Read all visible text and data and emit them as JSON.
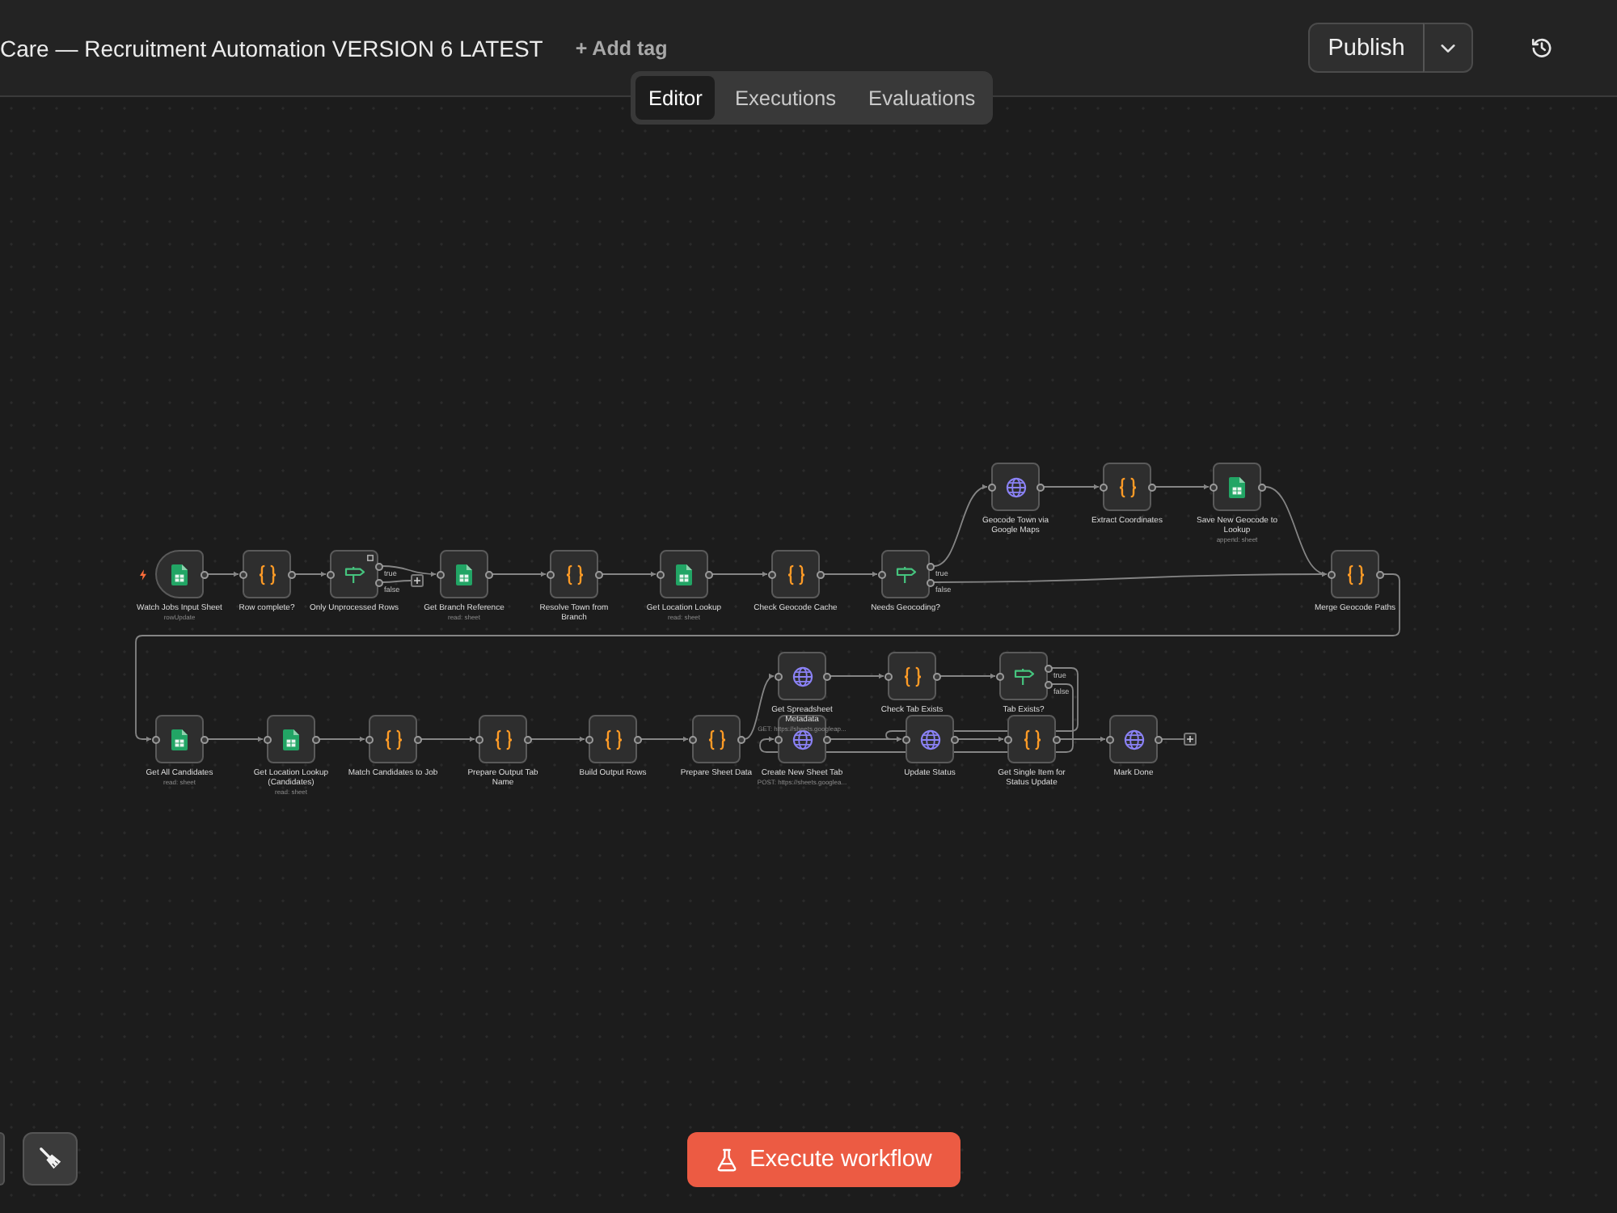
{
  "header": {
    "title": "Care — Recruitment Automation VERSION 6 LATEST",
    "add_tag": "+ Add tag",
    "publish": "Publish"
  },
  "tabs": [
    {
      "label": "Editor",
      "selected": true
    },
    {
      "label": "Executions",
      "selected": false
    },
    {
      "label": "Evaluations",
      "selected": false
    }
  ],
  "nodes": [
    {
      "kind": "sheet",
      "label": "Watch Jobs Input Sheet",
      "subtitle": "rowUpdate",
      "trigger": true,
      "badge": false
    },
    {
      "kind": "code",
      "label": "Row complete?",
      "trigger": false,
      "badge": false
    },
    {
      "kind": "if",
      "label": "Only Unprocessed Rows",
      "outputs": [
        "true",
        "false"
      ],
      "trigger": false,
      "badge": true
    },
    {
      "kind": "sheet",
      "label": "Get Branch Reference",
      "subtitle": "read: sheet",
      "trigger": false,
      "badge": false
    },
    {
      "kind": "code",
      "label": "Resolve Town from Branch",
      "trigger": false,
      "badge": false
    },
    {
      "kind": "sheet",
      "label": "Get Location Lookup",
      "subtitle": "read: sheet",
      "trigger": false,
      "badge": false
    },
    {
      "kind": "code",
      "label": "Check Geocode Cache",
      "trigger": false,
      "badge": false
    },
    {
      "kind": "if",
      "label": "Needs Geocoding?",
      "outputs": [
        "true",
        "false"
      ],
      "trigger": false,
      "badge": false
    },
    {
      "kind": "http",
      "label": "Geocode Town via Google Maps",
      "trigger": false,
      "badge": false
    },
    {
      "kind": "code",
      "label": "Extract Coordinates",
      "trigger": false,
      "badge": false
    },
    {
      "kind": "sheet",
      "label": "Save New Geocode to Lookup",
      "subtitle": "append: sheet",
      "trigger": false,
      "badge": false
    },
    {
      "kind": "code",
      "label": "Merge Geocode Paths",
      "trigger": false,
      "badge": false
    },
    {
      "kind": "sheet",
      "label": "Get All Candidates",
      "subtitle": "read: sheet",
      "trigger": false,
      "badge": false
    },
    {
      "kind": "sheet",
      "label": "Get Location Lookup (Candidates)",
      "subtitle": "read: sheet",
      "trigger": false,
      "badge": false
    },
    {
      "kind": "code",
      "label": "Match Candidates to Job",
      "trigger": false,
      "badge": false
    },
    {
      "kind": "code",
      "label": "Prepare Output Tab Name",
      "trigger": false,
      "badge": false
    },
    {
      "kind": "code",
      "label": "Build Output Rows",
      "trigger": false,
      "badge": false
    },
    {
      "kind": "code",
      "label": "Prepare Sheet Data",
      "trigger": false,
      "badge": false
    },
    {
      "kind": "http",
      "label": "Get Spreadsheet Metadata",
      "subtitle": "GET: https://sheets.googleap...",
      "trigger": false,
      "badge": false
    },
    {
      "kind": "http",
      "label": "Create New Sheet Tab",
      "subtitle": "POST: https://sheets.googlea...",
      "trigger": false,
      "badge": false
    },
    {
      "kind": "code",
      "label": "Check Tab Exists",
      "trigger": false,
      "badge": false
    },
    {
      "kind": "if",
      "label": "Tab Exists?",
      "outputs": [
        "true",
        "false"
      ],
      "trigger": false,
      "badge": false
    },
    {
      "kind": "http",
      "label": "Update Status",
      "trigger": false,
      "badge": false
    },
    {
      "kind": "code",
      "label": "Get Single Item for Status Update",
      "trigger": false,
      "badge": false
    },
    {
      "kind": "http",
      "label": "Mark Done",
      "trigger": false,
      "badge": false
    }
  ],
  "execute_button": "Execute workflow"
}
